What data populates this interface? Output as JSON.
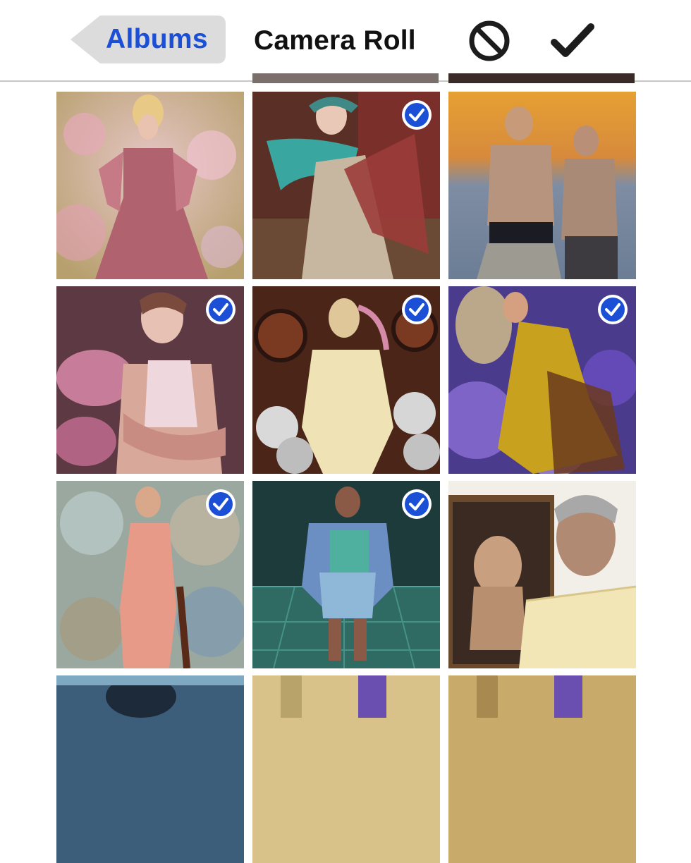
{
  "navbar": {
    "back_label": "Albums",
    "title": "Camera Roll",
    "cancel_icon": "prohibited-icon",
    "done_icon": "checkmark-icon"
  },
  "colors": {
    "accent": "#1a4fd6",
    "back_button_bg": "#dcdcdc",
    "checkmark_badge": "#1a4fd6"
  },
  "grid": {
    "photos": [
      {
        "selected": false
      },
      {
        "selected": true
      },
      {
        "selected": false
      },
      {
        "selected": true
      },
      {
        "selected": true
      },
      {
        "selected": true
      },
      {
        "selected": true
      },
      {
        "selected": true
      },
      {
        "selected": false
      }
    ]
  }
}
